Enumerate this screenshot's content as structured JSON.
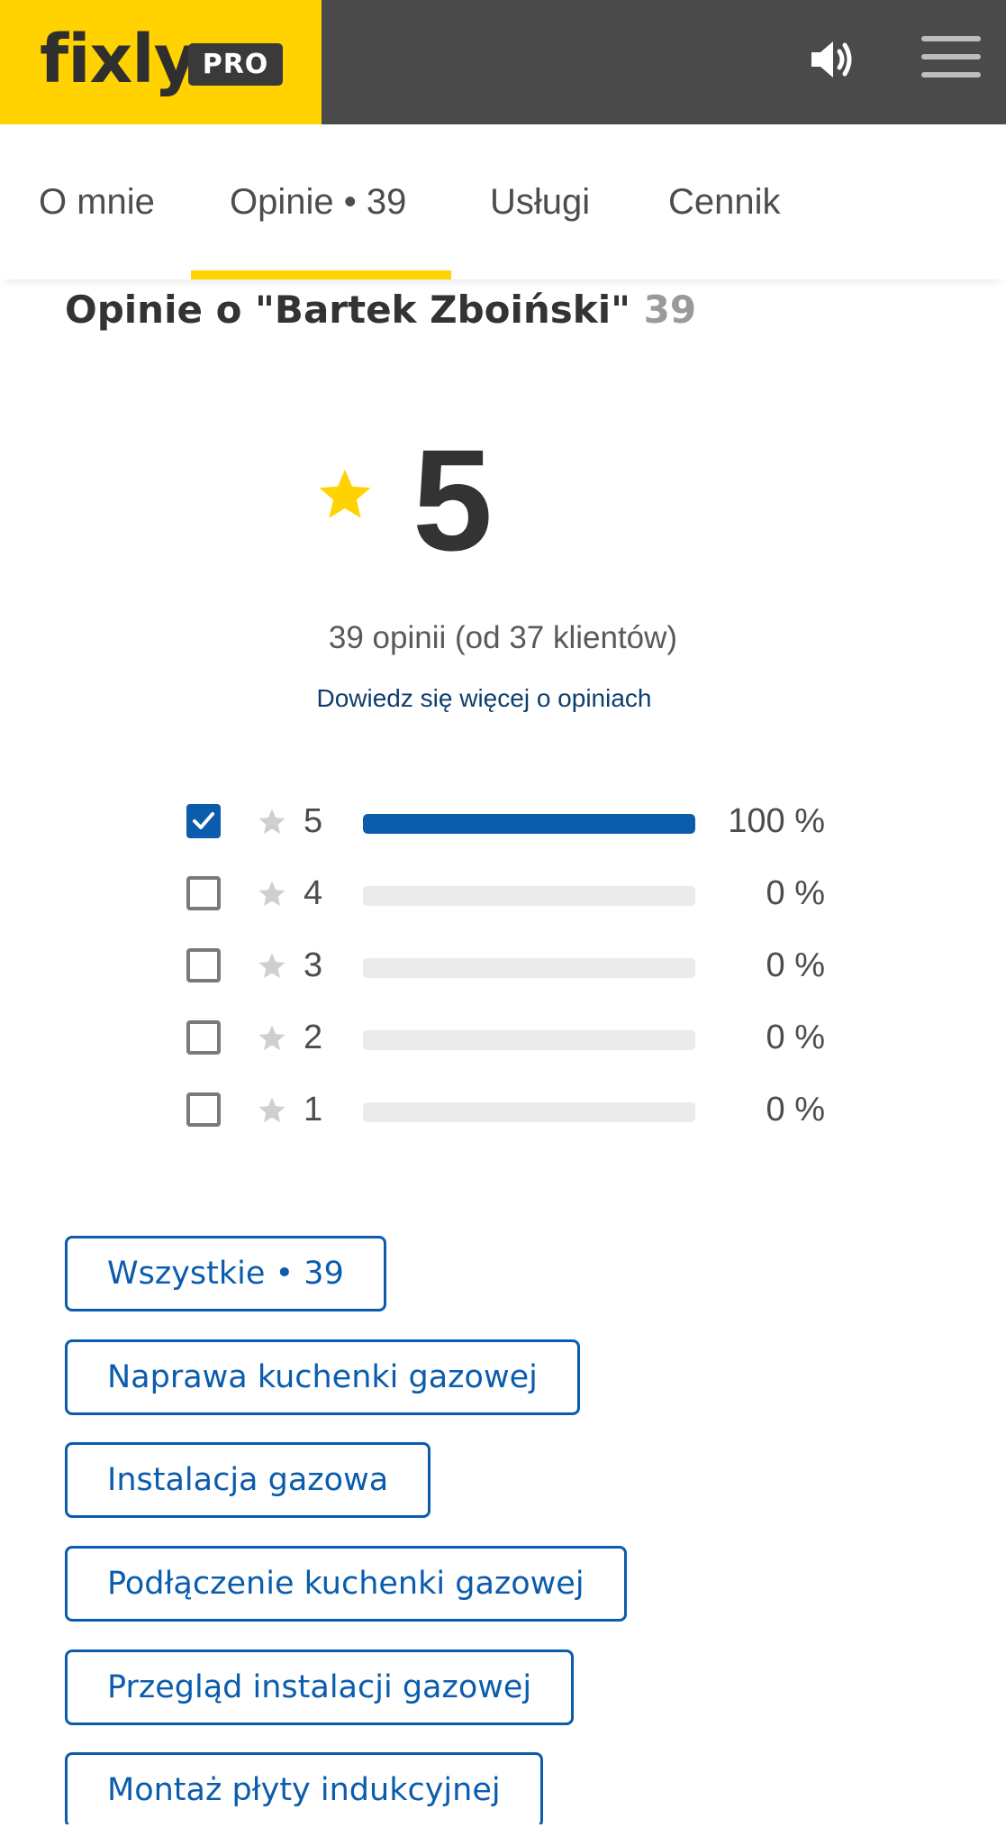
{
  "header": {
    "logo_text": "fixly",
    "badge": "PRO",
    "icons": {
      "speaker": "speaker-icon",
      "menu": "hamburger-menu-icon"
    },
    "brand_color": "#ffd200",
    "bar_color": "#4a4a4a"
  },
  "tabs": [
    {
      "label": "O mnie",
      "active": false
    },
    {
      "label": "Opinie • 39",
      "active": true
    },
    {
      "label": "Usługi",
      "active": false
    },
    {
      "label": "Cennik",
      "active": false
    }
  ],
  "reviews": {
    "title": "Opinie o \"Bartek Zboiński\"",
    "count": "39",
    "score": "5",
    "summary": "39 opinii (od 37 klientów)",
    "learn_more": "Dowiedz się więcej o opiniach",
    "accent_color": "#0b5cad",
    "rows": [
      {
        "stars": "5",
        "percent": "100 %",
        "fraction": 1.0,
        "checked": true
      },
      {
        "stars": "4",
        "percent": "0 %",
        "fraction": 0.0,
        "checked": false
      },
      {
        "stars": "3",
        "percent": "0 %",
        "fraction": 0.0,
        "checked": false
      },
      {
        "stars": "2",
        "percent": "0 %",
        "fraction": 0.0,
        "checked": false
      },
      {
        "stars": "1",
        "percent": "0 %",
        "fraction": 0.0,
        "checked": false
      }
    ]
  },
  "filters": [
    "Wszystkie • 39",
    "Naprawa kuchenki gazowej",
    "Instalacja gazowa",
    "Podłączenie kuchenki gazowej",
    "Przegląd instalacji gazowej",
    "Montaż płyty indukcyjnej"
  ]
}
